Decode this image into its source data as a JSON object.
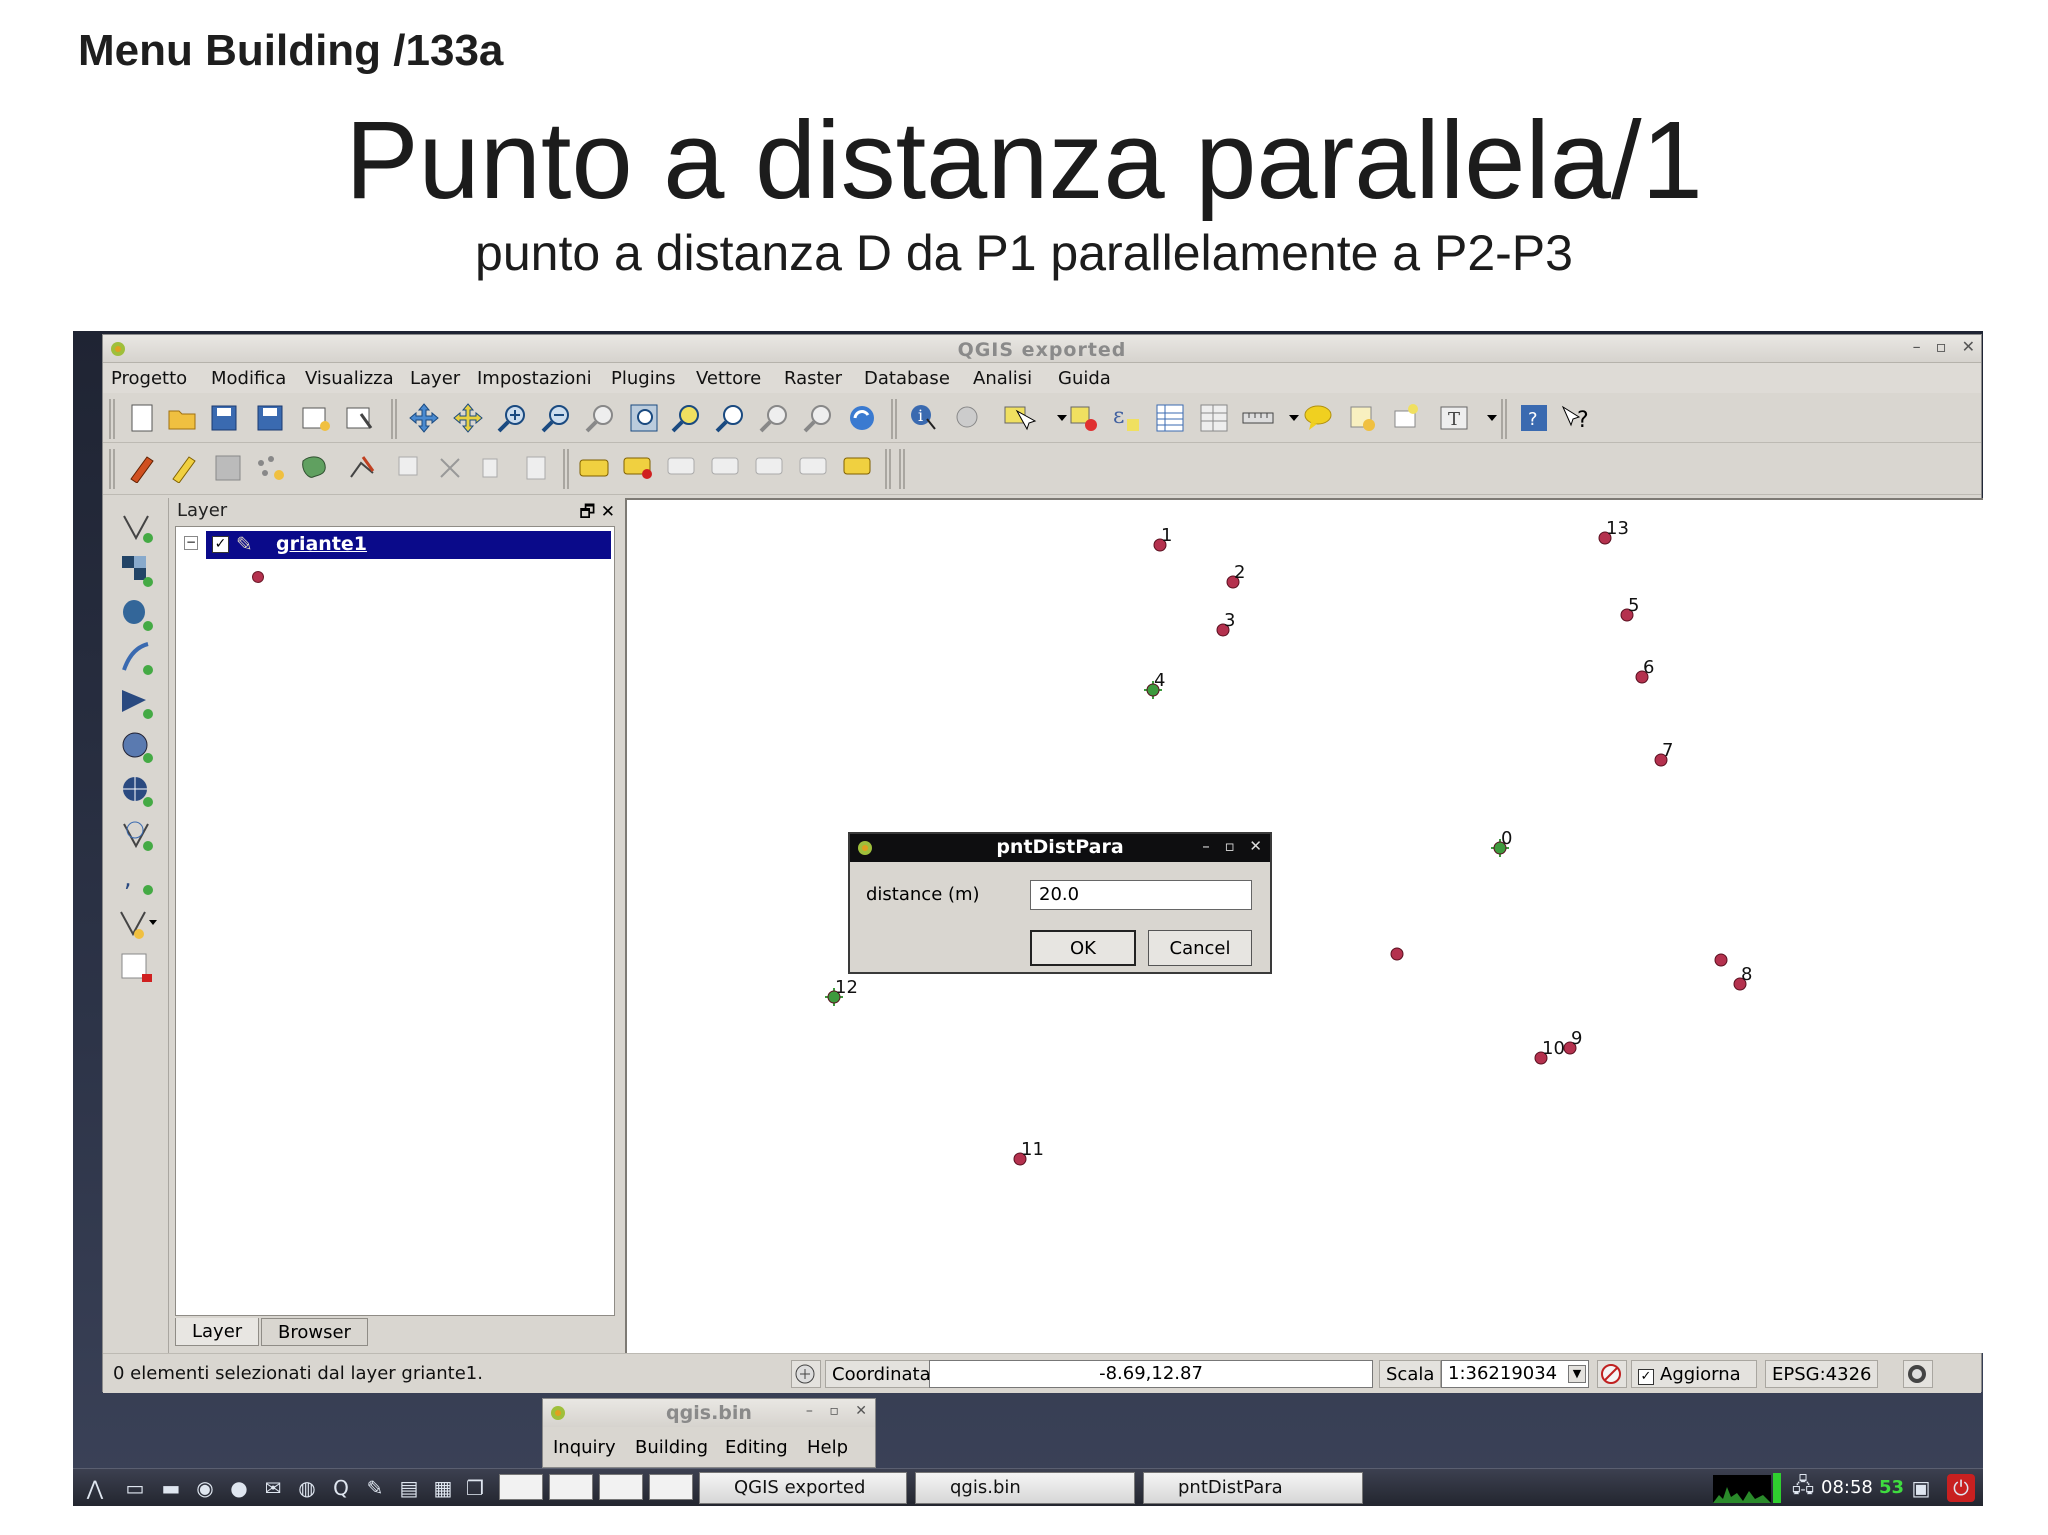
{
  "slide": {
    "header": "Menu Building /133a",
    "title": "Punto a distanza parallela/1",
    "subtitle": "punto a distanza D da P1 parallelamente a P2-P3"
  },
  "window": {
    "title": "QGIS exported",
    "menu": [
      "Progetto",
      "Modifica",
      "Visualizza",
      "Layer",
      "Impostazioni",
      "Plugins",
      "Vettore",
      "Raster",
      "Database",
      "Analisi",
      "Guida"
    ]
  },
  "layer_panel": {
    "title": "Layer",
    "layer_name": "griante1",
    "tabs": [
      "Layer",
      "Browser"
    ]
  },
  "map": {
    "points": [
      {
        "label": "1",
        "selected": false
      },
      {
        "label": "2",
        "selected": false
      },
      {
        "label": "3",
        "selected": false
      },
      {
        "label": "4",
        "selected": true
      },
      {
        "label": "13",
        "selected": false
      },
      {
        "label": "5",
        "selected": false
      },
      {
        "label": "6",
        "selected": false
      },
      {
        "label": "7",
        "selected": false
      },
      {
        "label": "0",
        "selected": true
      },
      {
        "label": "",
        "selected": false
      },
      {
        "label": "",
        "selected": false
      },
      {
        "label": "8",
        "selected": false
      },
      {
        "label": "12",
        "selected": true
      },
      {
        "label": "10",
        "selected": false
      },
      {
        "label": "9",
        "selected": false
      },
      {
        "label": "11",
        "selected": false
      }
    ]
  },
  "dialog": {
    "title": "pntDistPara",
    "label": "distance (m)",
    "value": "20.0",
    "ok": "OK",
    "cancel": "Cancel"
  },
  "statusbar": {
    "message": "0 elementi selezionati dal layer griante1.",
    "coord_label": "Coordinata:",
    "coord_value": "-8.69,12.87",
    "scale_label": "Scala",
    "scale_value": "1:36219034",
    "render_label": "Aggiorna",
    "epsg": "EPSG:4326"
  },
  "secondary_window": {
    "title": "qgis.bin",
    "menu": [
      "Inquiry",
      "Building",
      "Editing",
      "Help"
    ]
  },
  "taskbar": {
    "tasks": [
      "QGIS exported",
      "qgis.bin",
      "pntDistPara"
    ],
    "clock": "08:58",
    "seconds": "53"
  },
  "colors": {
    "point": "#b4314e",
    "selected_point": "#3d9a3d",
    "selection_bar": "#0a0a8a"
  }
}
